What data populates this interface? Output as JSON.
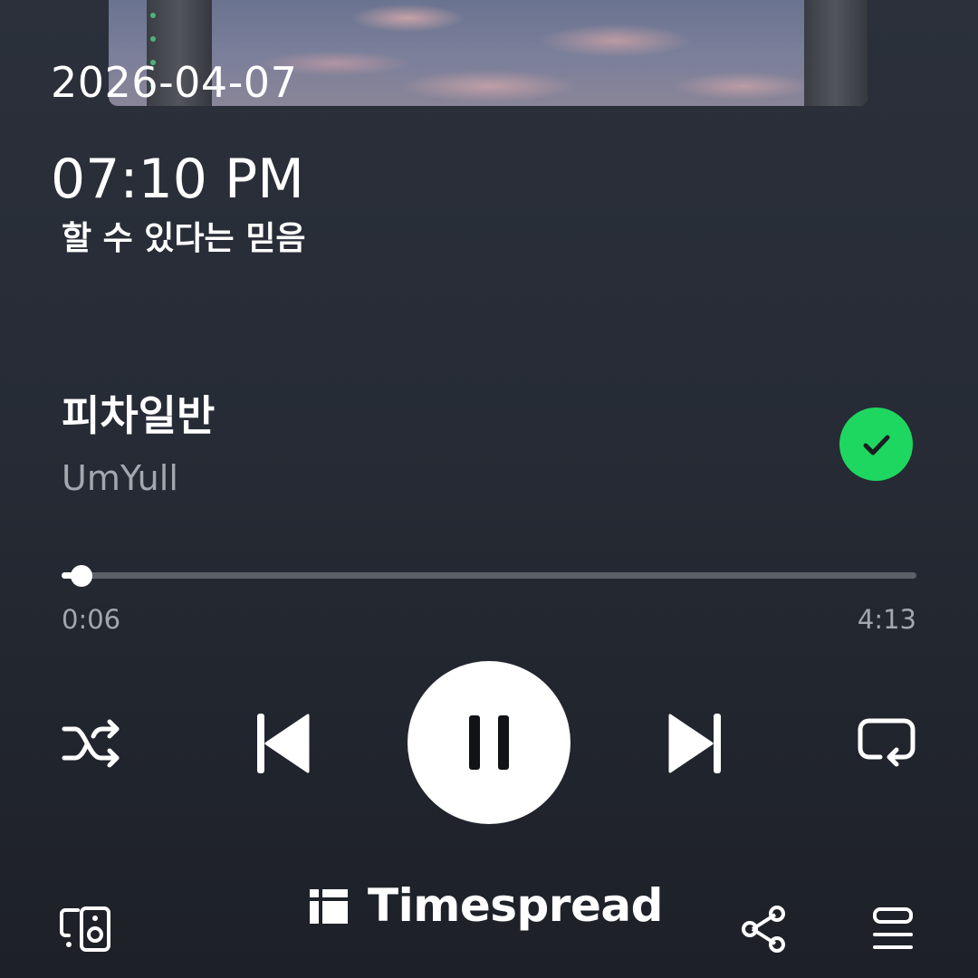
{
  "clock": {
    "date": "2026-04-07",
    "time": "07:10 PM",
    "caption": "할 수 있다는 믿음"
  },
  "track": {
    "title": "피차일반",
    "artist": "UmYull",
    "liked": true
  },
  "playback": {
    "elapsed": "0:06",
    "duration": "4:13",
    "progress_fraction": 0.0237,
    "state": "playing"
  },
  "controls": {
    "shuffle_icon": "shuffle-icon",
    "previous_icon": "skip-previous-icon",
    "pause_icon": "pause-icon",
    "next_icon": "skip-next-icon",
    "repeat_icon": "repeat-icon",
    "devices_icon": "connect-device-icon",
    "share_icon": "share-icon",
    "queue_icon": "queue-icon"
  },
  "brand": {
    "name": "Timespread"
  },
  "colors": {
    "accent": "#1ed760",
    "background_top": "#2b303b",
    "background_bottom": "#1d2027",
    "secondary_text": "#a3a7af"
  }
}
